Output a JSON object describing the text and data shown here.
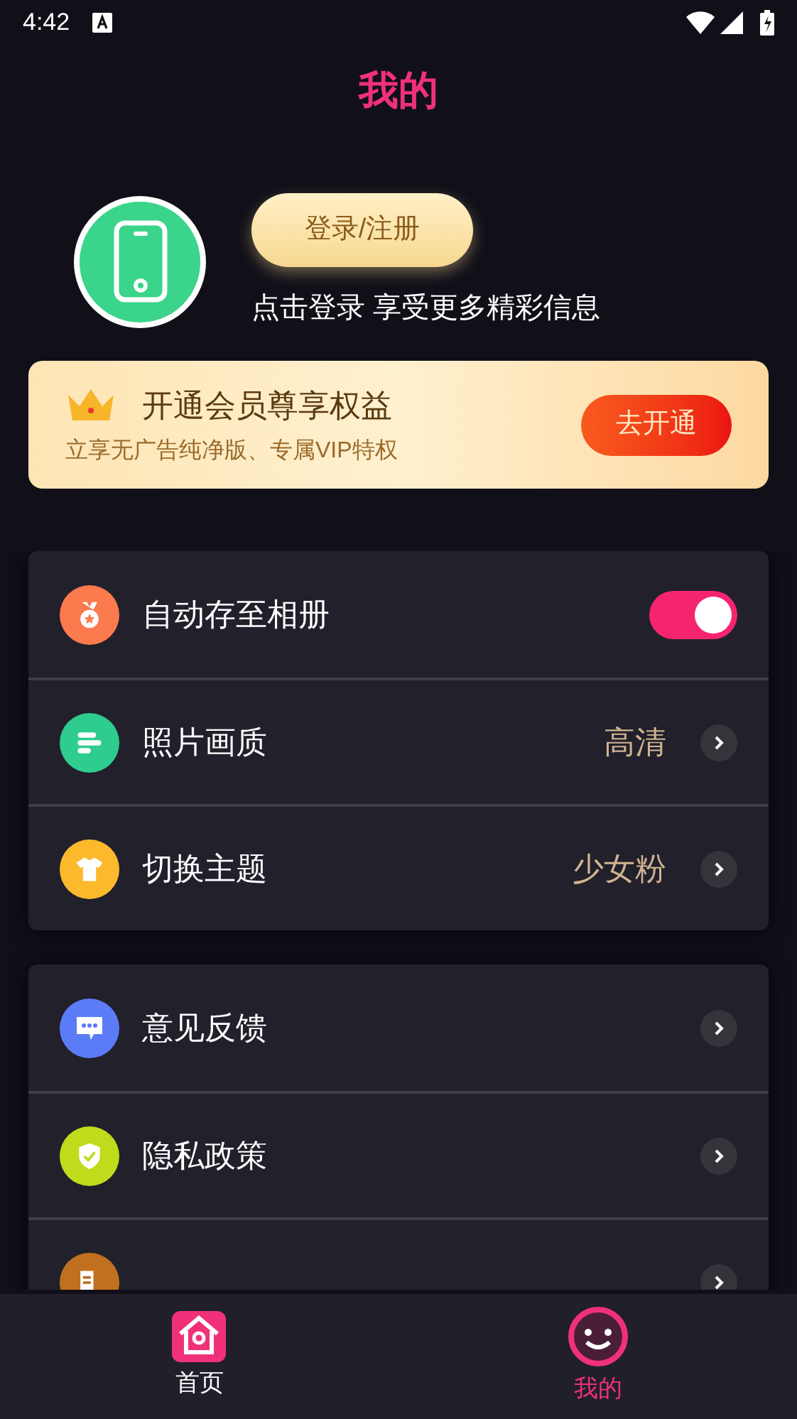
{
  "status_bar": {
    "time": "4:42"
  },
  "header": {
    "title": "我的"
  },
  "profile": {
    "login_button": "登录/注册",
    "hint": "点击登录 享受更多精彩信息"
  },
  "vip_banner": {
    "title": "开通会员尊享权益",
    "subtitle": "立享无广告纯净版、专属VIP特权",
    "button": "去开通"
  },
  "settings_groups": [
    {
      "items": [
        {
          "kind": "toggle",
          "label": "自动存至相册",
          "color": "#fb7a4e",
          "on": true
        },
        {
          "kind": "value",
          "label": "照片画质",
          "color": "#2ecc8f",
          "value": "高清"
        },
        {
          "kind": "value",
          "label": "切换主题",
          "color": "#fcb92c",
          "value": "少女粉"
        }
      ]
    },
    {
      "items": [
        {
          "kind": "link",
          "label": "意见反馈",
          "color": "#5b7cf6"
        },
        {
          "kind": "link",
          "label": "隐私政策",
          "color": "#c0db1c"
        },
        {
          "kind": "link",
          "color": "#c0701e"
        }
      ]
    }
  ],
  "tab_bar": [
    {
      "label": "首页",
      "selected": false
    },
    {
      "label": "我的",
      "selected": true
    }
  ]
}
